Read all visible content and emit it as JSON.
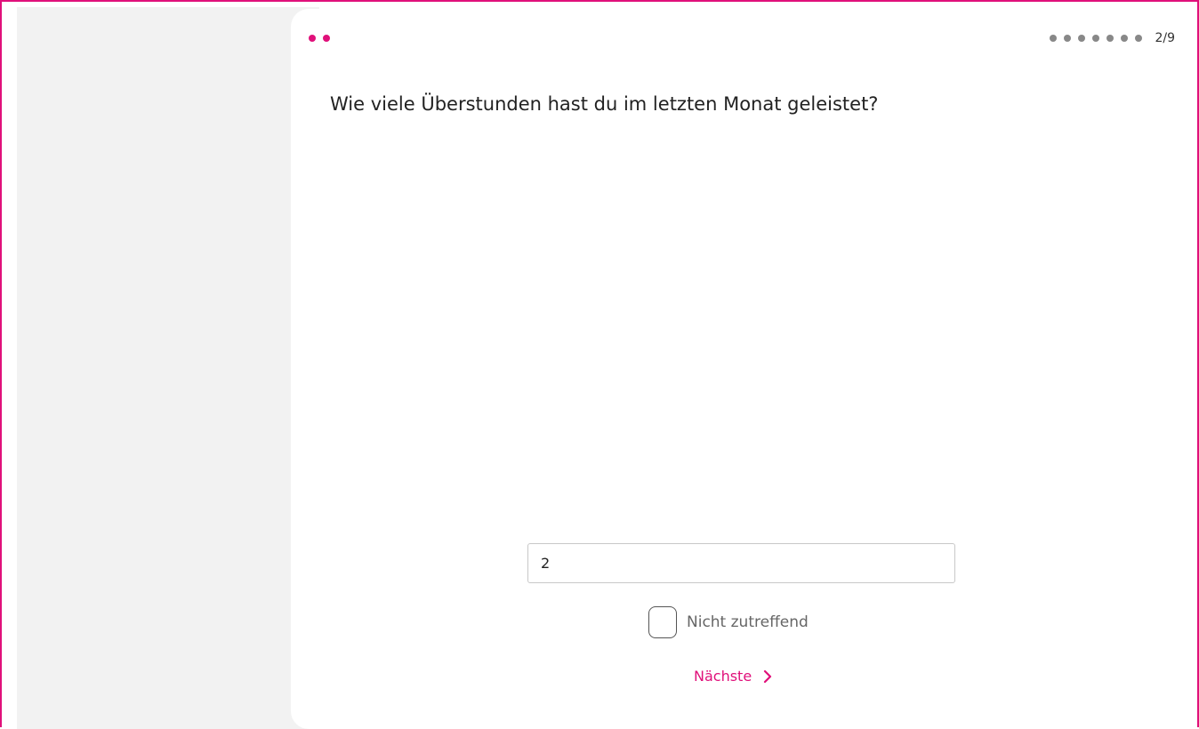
{
  "colors": {
    "accent": "#e0107a",
    "side_panel": "#f2f2f2",
    "progress_dot": "#888888"
  },
  "header": {
    "brand_icon": "two-dots-logo",
    "progress": {
      "current": 2,
      "total": 9,
      "dots_count": 7,
      "counter_text": "2/9"
    }
  },
  "question": {
    "text": "Wie viele Überstunden hast du im letzten Monat geleistet?"
  },
  "answer": {
    "value": "2",
    "placeholder": ""
  },
  "not_applicable": {
    "label": "Nicht zutreffend",
    "checked": false
  },
  "navigation": {
    "next_label": "Nächste",
    "next_icon": "chevron-right-icon"
  }
}
